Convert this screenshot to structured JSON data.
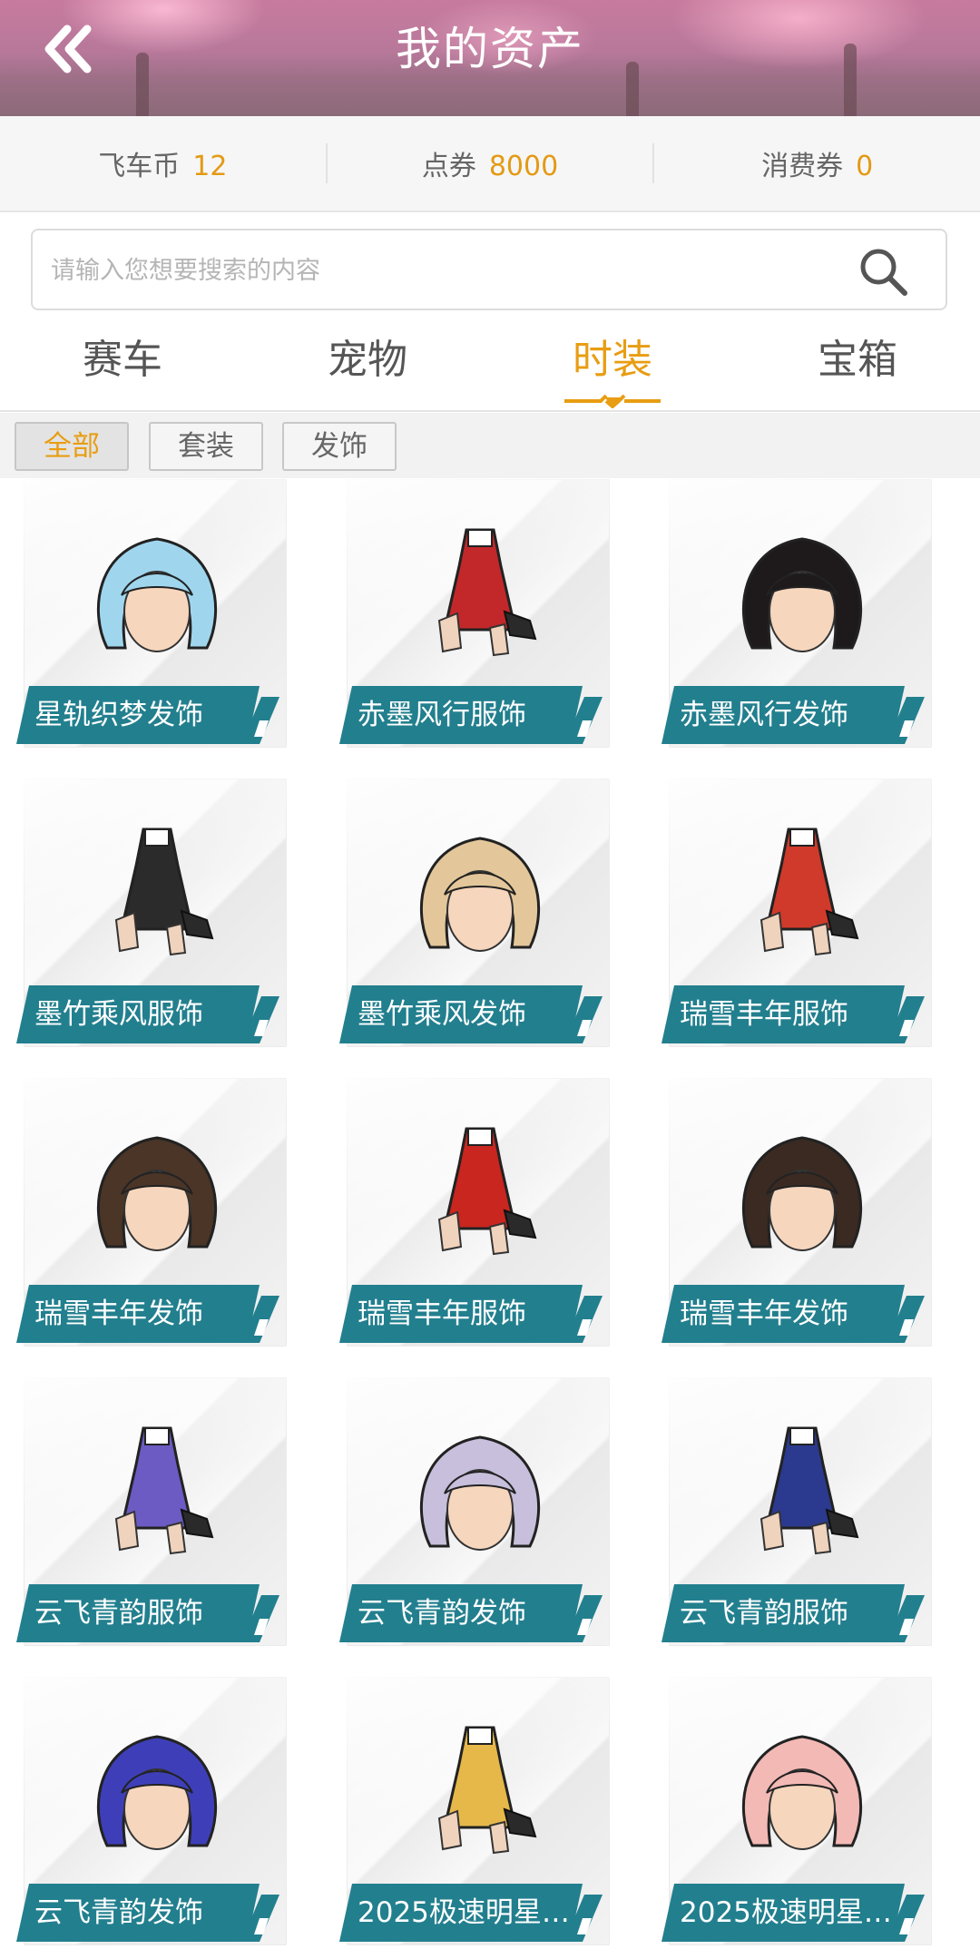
{
  "header": {
    "title": "我的资产",
    "back_icon": "double-chevron-left-icon"
  },
  "currency": [
    {
      "label": "飞车币",
      "value": "12"
    },
    {
      "label": "点券",
      "value": "8000"
    },
    {
      "label": "消费券",
      "value": "0"
    }
  ],
  "search": {
    "placeholder": "请输入您想要搜索的内容",
    "icon": "search-icon"
  },
  "tabs": [
    {
      "label": "赛车",
      "active": false
    },
    {
      "label": "宠物",
      "active": false
    },
    {
      "label": "时装",
      "active": true
    },
    {
      "label": "宝箱",
      "active": false
    }
  ],
  "filters": [
    {
      "label": "全部",
      "active": true
    },
    {
      "label": "套装",
      "active": false
    },
    {
      "label": "发饰",
      "active": false
    }
  ],
  "colors": {
    "accent": "#e89d12",
    "label_bg": "#227f8e"
  },
  "items": [
    {
      "name": "星轨织梦发饰",
      "kind": "hair",
      "color": "#9fd6ee"
    },
    {
      "name": "赤墨风行服饰",
      "kind": "outfit",
      "color": "#c2282a"
    },
    {
      "name": "赤墨风行发饰",
      "kind": "hair",
      "color": "#1e1a1c"
    },
    {
      "name": "墨竹乘风服饰",
      "kind": "outfit",
      "color": "#2b2b2b"
    },
    {
      "name": "墨竹乘风发饰",
      "kind": "hair",
      "color": "#e3c79a"
    },
    {
      "name": "瑞雪丰年服饰",
      "kind": "outfit",
      "color": "#d03a2a"
    },
    {
      "name": "瑞雪丰年发饰",
      "kind": "hair",
      "color": "#4a3527"
    },
    {
      "name": "瑞雪丰年服饰",
      "kind": "outfit",
      "color": "#c8261f"
    },
    {
      "name": "瑞雪丰年发饰",
      "kind": "hair",
      "color": "#3a2a22"
    },
    {
      "name": "云飞青韵服饰",
      "kind": "outfit",
      "color": "#6b5bc2"
    },
    {
      "name": "云飞青韵发饰",
      "kind": "hair",
      "color": "#c7bfdb"
    },
    {
      "name": "云飞青韵服饰",
      "kind": "outfit",
      "color": "#2b3a8f"
    },
    {
      "name": "云飞青韵发饰",
      "kind": "hair",
      "color": "#3e3fb8"
    },
    {
      "name": "2025极速明星…",
      "kind": "outfit",
      "color": "#e6b84a"
    },
    {
      "name": "2025极速明星…",
      "kind": "hair",
      "color": "#f3b9b5"
    }
  ]
}
